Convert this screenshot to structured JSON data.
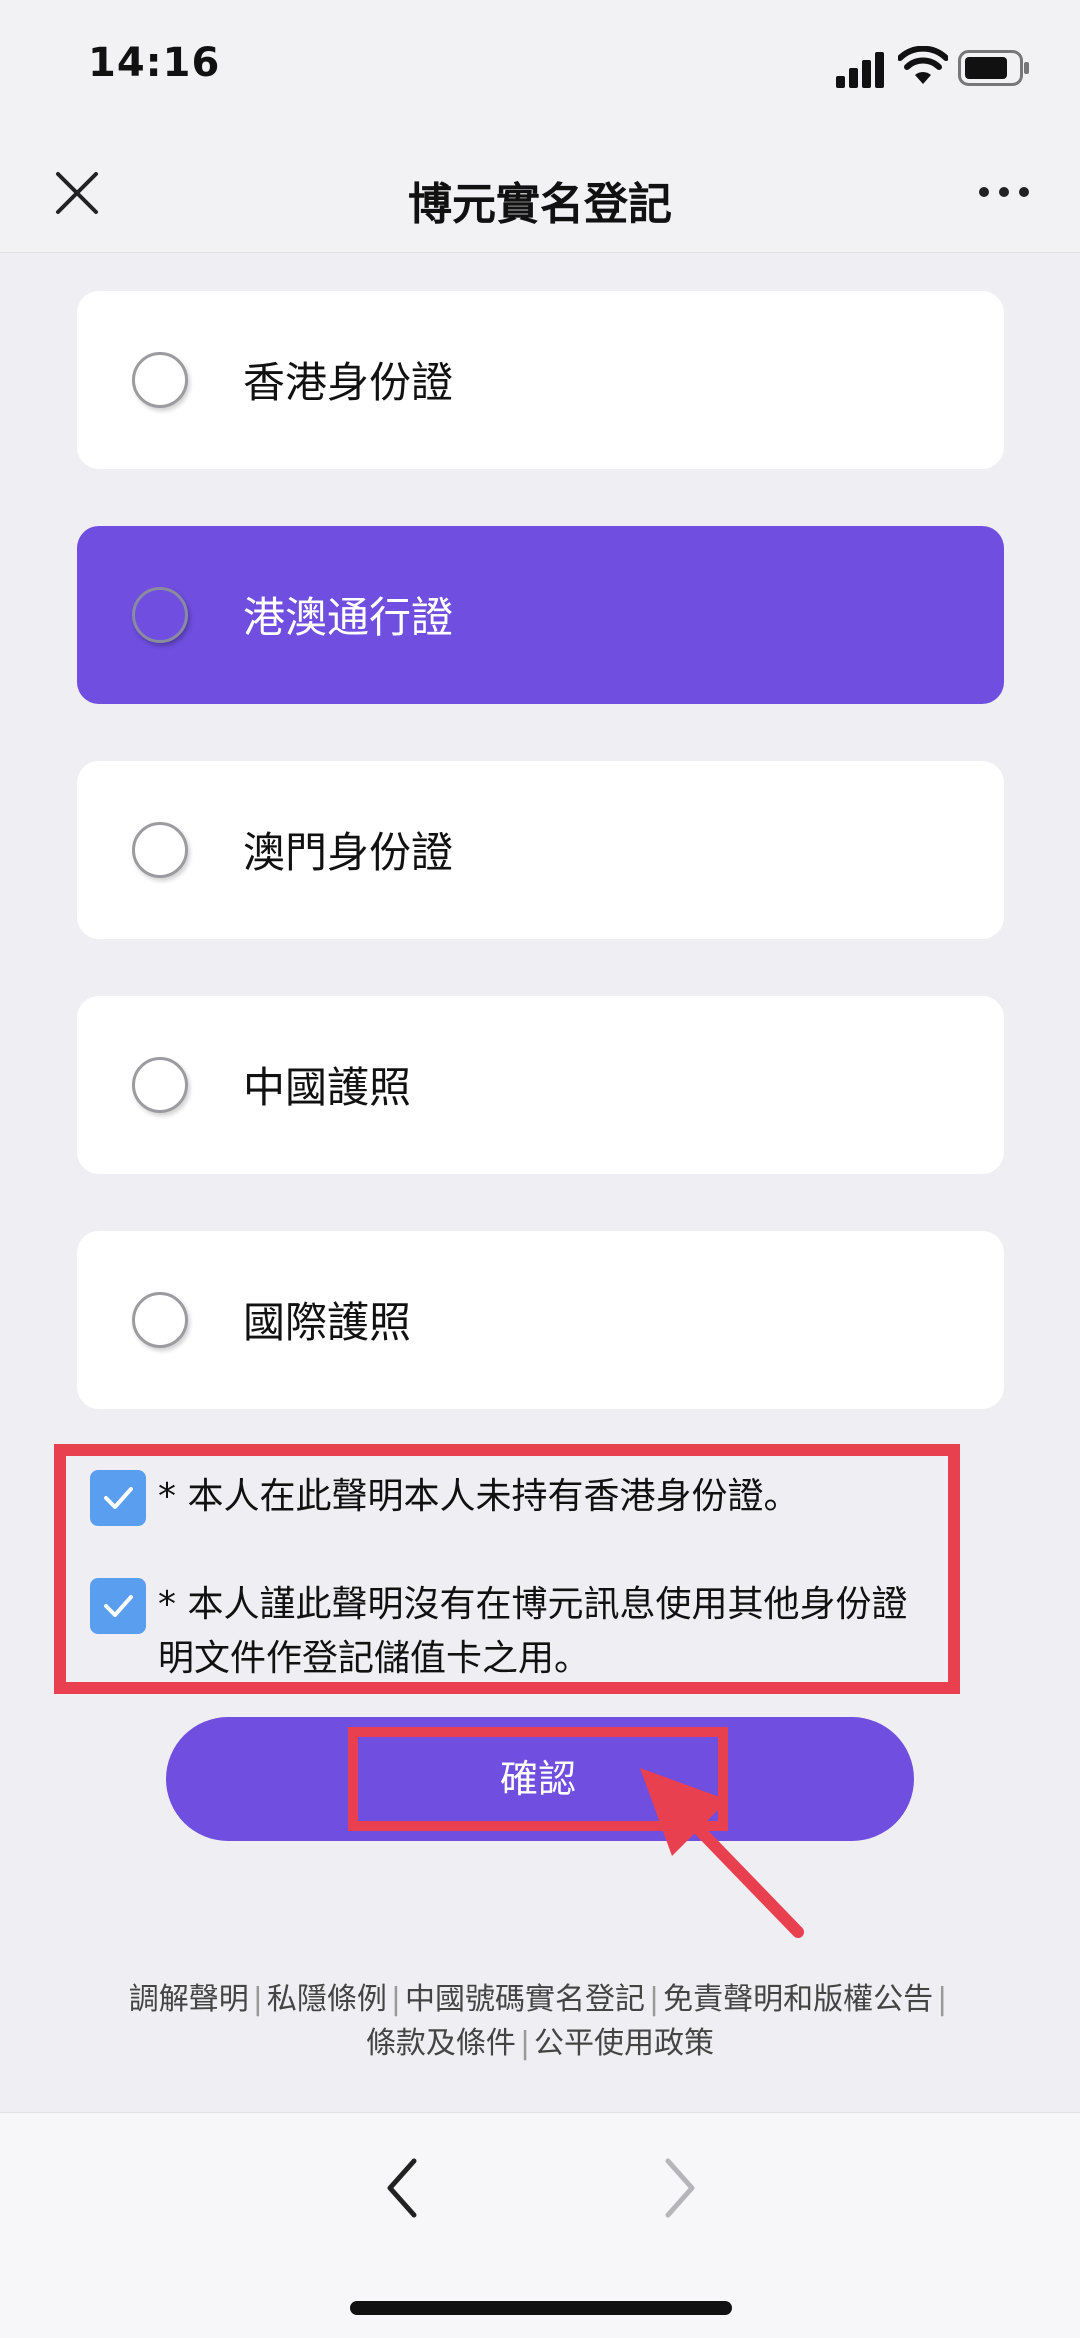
{
  "status_bar": {
    "time": "14:16"
  },
  "nav": {
    "title": "博元實名登記"
  },
  "options": [
    {
      "label": "香港身份證",
      "selected": false
    },
    {
      "label": "港澳通行證",
      "selected": true
    },
    {
      "label": "澳門身份證",
      "selected": false
    },
    {
      "label": "中國護照",
      "selected": false
    },
    {
      "label": "國際護照",
      "selected": false
    }
  ],
  "declarations": [
    {
      "text": "* 本人在此聲明本人未持有香港身份證。",
      "checked": true
    },
    {
      "text": "* 本人謹此聲明沒有在博元訊息使用其他身份證明文件作登記儲值卡之用。",
      "checked": true
    }
  ],
  "confirm": {
    "label": "確認"
  },
  "footer": {
    "links": [
      "調解聲明",
      "私隱條例",
      "中國號碼實名登記",
      "免責聲明和版權公告",
      "條款及條件",
      "公平使用政策"
    ],
    "separator": "|"
  },
  "colors": {
    "accent": "#6f4ee0",
    "highlight": "#e8404f",
    "checkbox": "#5a9ef0"
  }
}
